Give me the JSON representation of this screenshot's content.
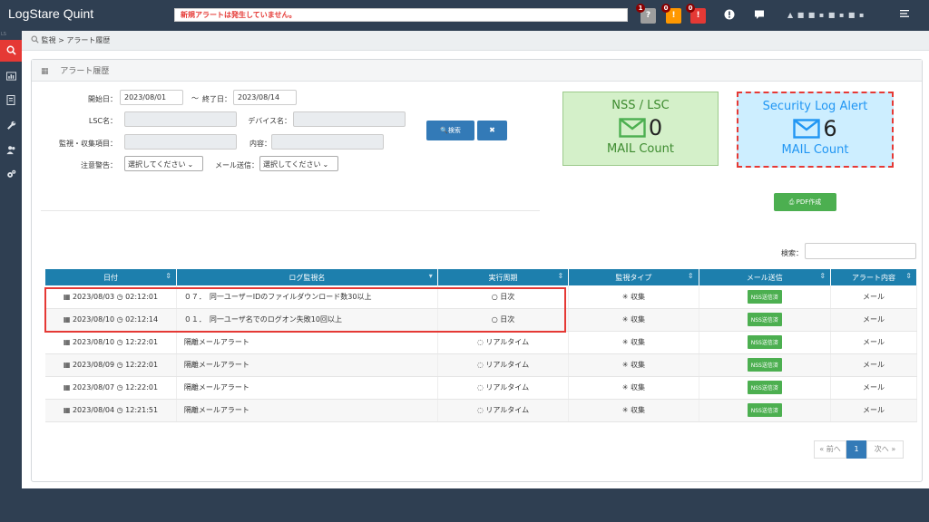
{
  "app": {
    "title": "LogStare Quint"
  },
  "topbar": {
    "alert_message": "新規アラートは発生していません。",
    "notifications": [
      {
        "icon": "question-circle-icon",
        "glyph": "?",
        "count": "1",
        "color": "#9e9e9e"
      },
      {
        "icon": "warning-icon",
        "glyph": "!",
        "count": "0",
        "color": "#ff9800"
      },
      {
        "icon": "error-icon",
        "glyph": "!",
        "count": "0",
        "color": "#e53935"
      }
    ],
    "user_text": "▲ ■ ■ ▪ ■ ▪ ■ ▪",
    "sidebar_small_label": "LS"
  },
  "breadcrumb": {
    "monitor": "監視",
    "separator": ">",
    "current": "アラート履歴"
  },
  "panel": {
    "title": "アラート履歴"
  },
  "form": {
    "start_label": "開始日：",
    "start_value": "2023/08/01",
    "tilde": "～",
    "end_label": "終了日：",
    "end_value": "2023/08/14",
    "lsc_label": "LSC名：",
    "device_label": "デバイス名：",
    "item_label": "監視・収集項目：",
    "content_label": "内容：",
    "warning_label": "注意警告：",
    "warning_select": "選択してください",
    "mail_label": "メール送信：",
    "mail_select": "選択してください",
    "search_button": "検索",
    "clear_button": "✖"
  },
  "cards": {
    "nss": {
      "title": "NSS / LSC",
      "count": "0",
      "footer": "MAIL Count"
    },
    "security": {
      "title": "Security Log Alert",
      "count": "6",
      "footer": "MAIL Count"
    }
  },
  "pdf_button": "PDF作成",
  "search": {
    "label": "検索："
  },
  "table": {
    "headers": [
      "日付",
      "ログ監視名",
      "実行周期",
      "監視タイプ",
      "メール送信",
      "アラート内容"
    ],
    "rows": [
      {
        "date": "2023/08/03",
        "time": "02:12:01",
        "name": "０７．　同一ユーザーIDのファイルダウンロード数30以上",
        "cycle": "日次",
        "type": "収集",
        "mail": "NSS送信済",
        "content": "メール"
      },
      {
        "date": "2023/08/10",
        "time": "02:12:14",
        "name": "０１．　同一ユーザ名でのログオン失敗10回以上",
        "cycle": "日次",
        "type": "収集",
        "mail": "NSS送信済",
        "content": "メール"
      },
      {
        "date": "2023/08/10",
        "time": "12:22:01",
        "name": "隔離メールアラート",
        "cycle": "リアルタイム",
        "type": "収集",
        "mail": "NSS送信済",
        "content": "メール"
      },
      {
        "date": "2023/08/09",
        "time": "12:22:01",
        "name": "隔離メールアラート",
        "cycle": "リアルタイム",
        "type": "収集",
        "mail": "NSS送信済",
        "content": "メール"
      },
      {
        "date": "2023/08/07",
        "time": "12:22:01",
        "name": "隔離メールアラート",
        "cycle": "リアルタイム",
        "type": "収集",
        "mail": "NSS送信済",
        "content": "メール"
      },
      {
        "date": "2023/08/04",
        "time": "12:21:51",
        "name": "隔離メールアラート",
        "cycle": "リアルタイム",
        "type": "収集",
        "mail": "NSS送信済",
        "content": "メール"
      }
    ]
  },
  "pagination": {
    "prev": "« 前へ",
    "page": "1",
    "next": "次へ »"
  },
  "colors": {
    "accent_red": "#e53935",
    "header_blue": "#1d7fad",
    "nss_green": "#4caf50",
    "security_blue": "#2196f3"
  }
}
